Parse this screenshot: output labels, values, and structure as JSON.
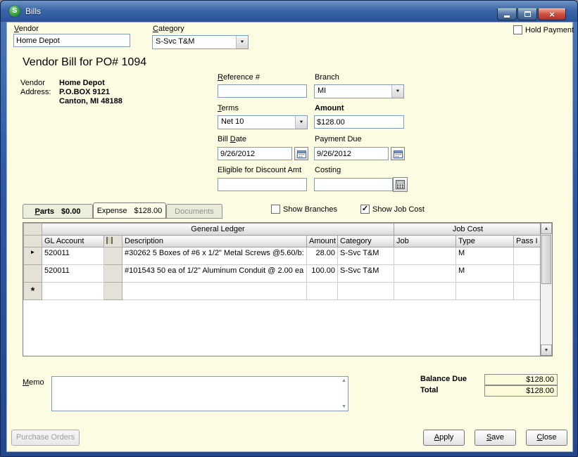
{
  "window": {
    "title": "Bills"
  },
  "icons": {
    "app_glyph": "S",
    "close_glyph": "×",
    "dropdown_glyph": "▼",
    "up_glyph": "▲",
    "down_glyph": "▼",
    "row_current_glyph": "►",
    "row_new_glyph": "*"
  },
  "header": {
    "vendor_label": "Vendor",
    "vendor_value": "Home Depot",
    "category_label": "Category",
    "category_value": "S-Svc T&M",
    "hold_payment_label": "Hold Payment",
    "hold_payment_glyph": ""
  },
  "bill": {
    "title": "Vendor Bill for PO# 1094",
    "address_label_line1": "Vendor",
    "address_label_line2": "Address:",
    "vendor_name": "Home Depot",
    "address_line1": "P.O.BOX 9121",
    "address_line2": "Canton, MI  48188",
    "reference_label": "Reference #",
    "reference_value": "",
    "branch_label": "Branch",
    "branch_value": "MI",
    "terms_label": "Terms",
    "terms_value": "Net 10",
    "amount_label": "Amount",
    "amount_value": "$128.00",
    "bill_date_label": "Bill Date",
    "bill_date_value": "9/26/2012",
    "payment_due_label": "Payment Due",
    "payment_due_value": "9/26/2012",
    "discount_label": "Eligible for Discount Amt",
    "discount_value": "",
    "costing_label": "Costing",
    "costing_value": ""
  },
  "tabs": {
    "parts_label": "Parts",
    "parts_amount": "$0.00",
    "expense_label": "Expense",
    "expense_amount": "$128.00",
    "documents_label": "Documents"
  },
  "options": {
    "show_branches_label": "Show Branches",
    "show_branches_glyph": "",
    "show_job_cost_label": "Show Job Cost",
    "show_job_cost_glyph": "✓"
  },
  "grid": {
    "group_headers": [
      "General Ledger",
      "Job Cost"
    ],
    "columns": [
      "GL Account",
      "Description",
      "Amount",
      "Category",
      "Job",
      "Type",
      "Pass I"
    ],
    "rows": [
      {
        "gl_account": "520011",
        "description": "#30262 5 Boxes of #6 x 1/2\" Metal Screws @5.60/b:",
        "amount": "28.00",
        "category": "S-Svc T&M",
        "job": "",
        "type": "M",
        "pass": ""
      },
      {
        "gl_account": "520011",
        "description": "#101543 50 ea of 1/2\" Aluminum Conduit @ 2.00 ea",
        "amount": "100.00",
        "category": "S-Svc T&M",
        "job": "",
        "type": "M",
        "pass": ""
      }
    ]
  },
  "footer": {
    "memo_label": "Memo",
    "memo_value": "",
    "balance_due_label": "Balance Due",
    "total_label": "Total",
    "balance_due_value": "$128.00",
    "total_value": "$128.00"
  },
  "buttons": {
    "purchase_orders": "Purchase Orders",
    "apply": "Apply",
    "save": "Save",
    "close": "Close"
  },
  "colors": {
    "window_chrome": "#2d58a7",
    "content_bg": "#fcfce3",
    "close_button": "#cf5340"
  }
}
